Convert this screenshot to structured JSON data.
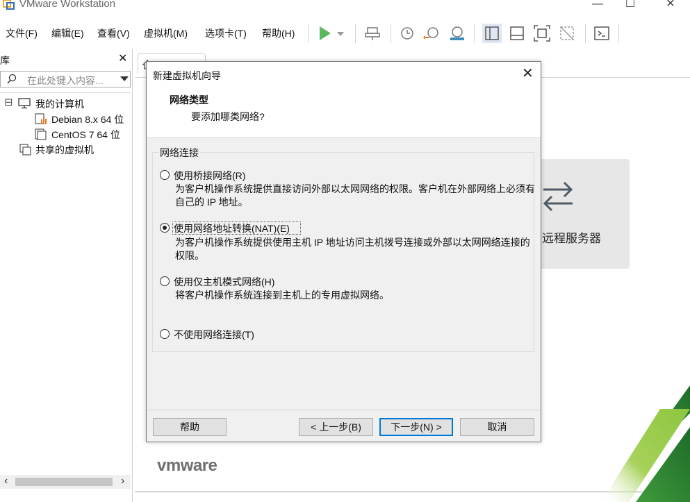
{
  "window": {
    "title": "VMware Workstation",
    "controls": {
      "minimize": "—",
      "maximize": "☐",
      "close": "✕"
    }
  },
  "menu": {
    "items": [
      "文件(F)",
      "编辑(E)",
      "查看(V)",
      "虚拟机(M)",
      "选项卡(T)",
      "帮助(H)"
    ]
  },
  "toolbar": {
    "icons": [
      "play-icon",
      "dropdown-icon",
      "send-keys-icon",
      "snapshot-icon",
      "revert-snapshot-icon",
      "manage-snapshots-icon",
      "library-view-icon",
      "thumbnail-bar-icon",
      "fullscreen-icon",
      "unity-icon",
      "console-icon"
    ],
    "accent_play": "#5cb85c"
  },
  "library": {
    "title": "库",
    "close": "✕",
    "search_placeholder": "在此处键入内容...",
    "tree": {
      "my_computer": "我的计算机",
      "vm1": "Debian 8.x 64 位",
      "vm2": "CentOS 7 64 位",
      "shared": "共享的虚拟机"
    },
    "expand_glyph": "⊟",
    "scroll_left": "‹",
    "scroll_right": "›"
  },
  "main": {
    "remote_server_label": "远程服务器",
    "logo": "vmware"
  },
  "dialog": {
    "title": "新建虚拟机向导",
    "close": "✕",
    "heading": "网络类型",
    "subheading": "要添加哪类网络?",
    "group_label": "网络连接",
    "options": [
      {
        "label": "使用桥接网络(R)",
        "desc": "为客户机操作系统提供直接访问外部以太网网络的权限。客户机在外部网络上必须有自己的 IP 地址。",
        "checked": false
      },
      {
        "label": "使用网络地址转换(NAT)(E)",
        "desc": "为客户机操作系统提供使用主机 IP 地址访问主机拨号连接或外部以太网网络连接的权限。",
        "checked": true
      },
      {
        "label": "使用仅主机模式网络(H)",
        "desc": "将客户机操作系统连接到主机上的专用虚拟网络。",
        "checked": false
      },
      {
        "label": "不使用网络连接(T)",
        "desc": "",
        "checked": false
      }
    ],
    "buttons": {
      "help": "帮助",
      "back": "< 上一步(B)",
      "next": "下一步(N) >",
      "cancel": "取消"
    }
  },
  "colors": {
    "dialog_bg": "#f0f0f0",
    "default_button_border": "#0078d7",
    "green_light": "#8cc63f",
    "green_dark": "#2e7d32"
  }
}
